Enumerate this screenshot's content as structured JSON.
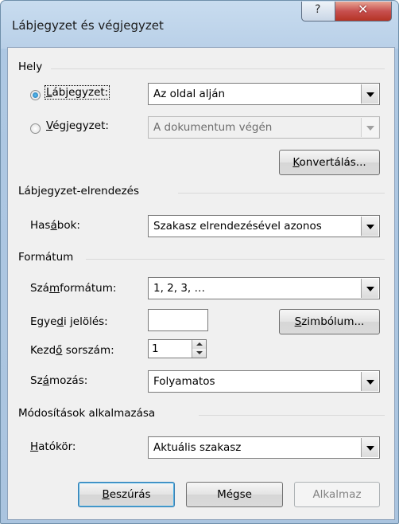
{
  "window": {
    "title": "Lábjegyzet és végjegyzet",
    "help_glyph": "?",
    "close_glyph": "✕"
  },
  "location": {
    "heading": "Hely",
    "footnote": {
      "label_pre": "",
      "label_u": "L",
      "label_post": "ábjegyzet:",
      "value": "Az oldal alján",
      "selected": true
    },
    "endnote": {
      "label_pre": "",
      "label_u": "V",
      "label_post": "égjegyzet:",
      "value": "A dokumentum végén",
      "selected": false
    },
    "convert_button": {
      "pre": "",
      "u": "K",
      "post": "onvertálás..."
    }
  },
  "layout": {
    "heading": "Lábjegyzet-elrendezés",
    "columns": {
      "label_pre": "Has",
      "label_u": "á",
      "label_post": "bok:",
      "value": "Szakasz elrendezésével azonos"
    }
  },
  "format": {
    "heading": "Formátum",
    "number_format": {
      "label_pre": "Szá",
      "label_u": "m",
      "label_post": "formátum:",
      "value": "1, 2, 3, …"
    },
    "custom_mark": {
      "label_pre": "Egye",
      "label_u": "d",
      "label_post": "i jelölés:",
      "value": ""
    },
    "symbol_button": {
      "pre": "",
      "u": "S",
      "post": "zimbólum..."
    },
    "start_at": {
      "label_pre": "Kezd",
      "label_u": "ő",
      "label_post": " sorszám:",
      "value": "1"
    },
    "numbering": {
      "label_pre": "Sz",
      "label_u": "á",
      "label_post": "mozás:",
      "value": "Folyamatos"
    }
  },
  "apply": {
    "heading": "Módosítások alkalmazása",
    "scope": {
      "label_pre": "",
      "label_u": "H",
      "label_post": "atókör:",
      "value": "Aktuális szakasz"
    }
  },
  "buttons": {
    "insert": {
      "pre": "",
      "u": "B",
      "post": "eszúrás"
    },
    "cancel": "Mégse",
    "apply": "Alkalmaz"
  }
}
